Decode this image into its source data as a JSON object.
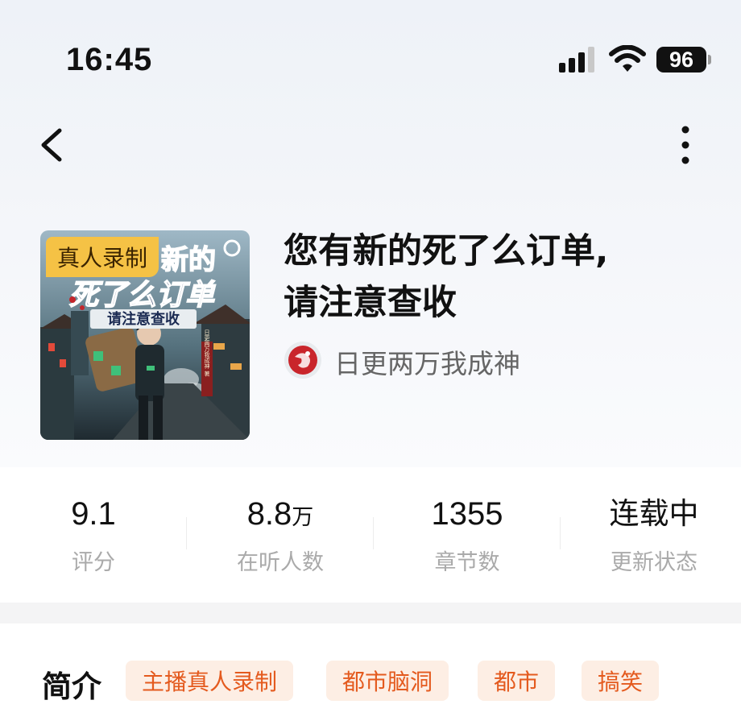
{
  "status_bar": {
    "time": "16:45",
    "battery": "96"
  },
  "nav": {
    "back_icon": "chevron-left-icon",
    "more_icon": "vertical-dots-icon"
  },
  "book": {
    "badge": "真人录制",
    "cover_text": {
      "line1": "新的",
      "line2": "死了么订单",
      "line3": "请注意查收",
      "seal": "日更两万我成神 著"
    },
    "title_line1": "您有新的死了么订单,",
    "title_line2": "请注意查收",
    "author": "日更两万我成神"
  },
  "stats": [
    {
      "value": "9.1",
      "unit": "",
      "label": "评分"
    },
    {
      "value": "8.8",
      "unit": "万",
      "label": "在听人数"
    },
    {
      "value": "1355",
      "unit": "",
      "label": "章节数"
    },
    {
      "value": "连载中",
      "unit": "",
      "label": "更新状态"
    }
  ],
  "intro": {
    "label": "简介",
    "tags": [
      "主播真人录制",
      "都市脑洞",
      "都市",
      "搞笑"
    ]
  },
  "colors": {
    "tag_text": "#e45a1e",
    "tag_bg": "#fdeee4",
    "badge_bg": "#f5c245"
  }
}
